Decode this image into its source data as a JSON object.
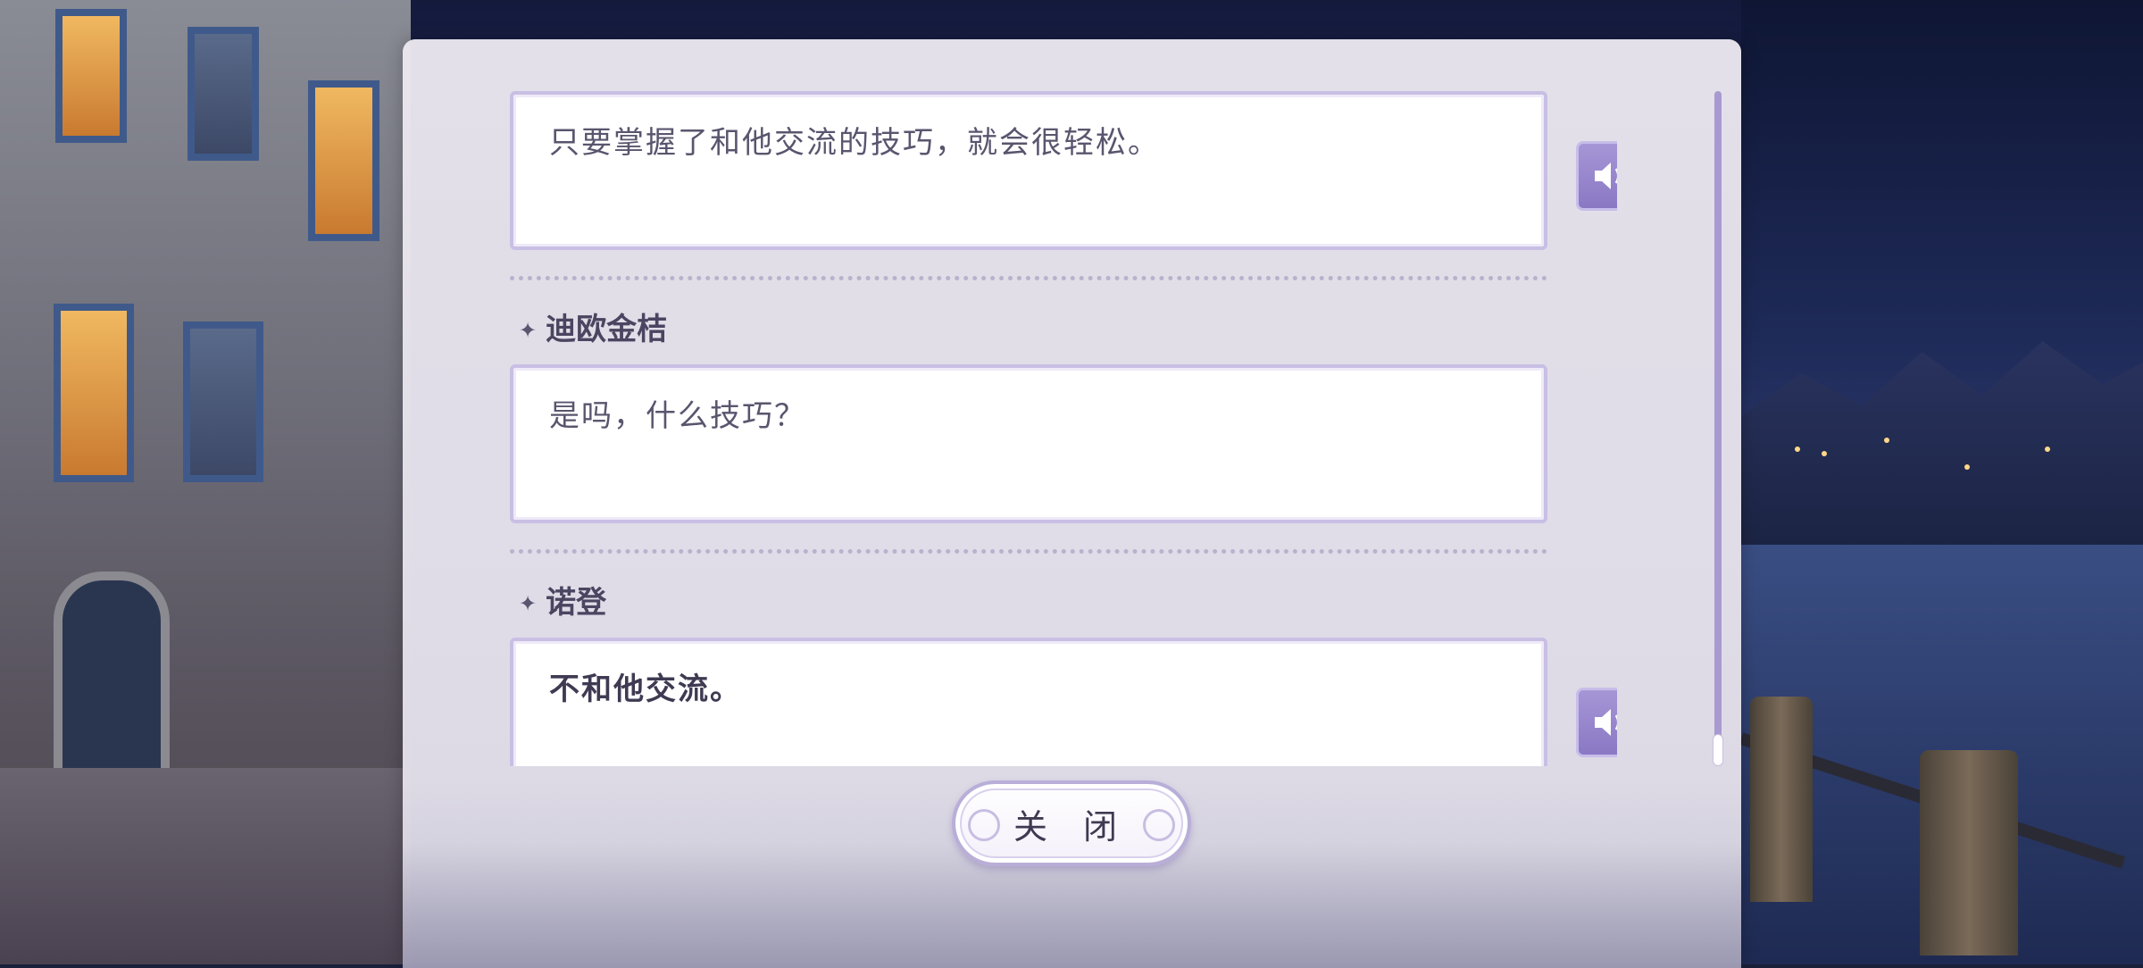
{
  "dialogue_log": {
    "entries": [
      {
        "speaker": "",
        "text": "只要掌握了和他交流的技巧，就会很轻松。",
        "has_voice": true,
        "bold": false
      },
      {
        "speaker": "迪欧金桔",
        "text": "是吗，什么技巧？",
        "has_voice": false,
        "bold": false
      },
      {
        "speaker": "诺登",
        "text": "不和他交流。",
        "has_voice": true,
        "bold": true
      }
    ],
    "scroll_position": 1.0
  },
  "buttons": {
    "close_label": "关 闭",
    "voice_icon": "speaker-icon"
  },
  "colors": {
    "accent": "#8a78c4",
    "panel": "#ece8f0",
    "text": "#4a4560"
  }
}
